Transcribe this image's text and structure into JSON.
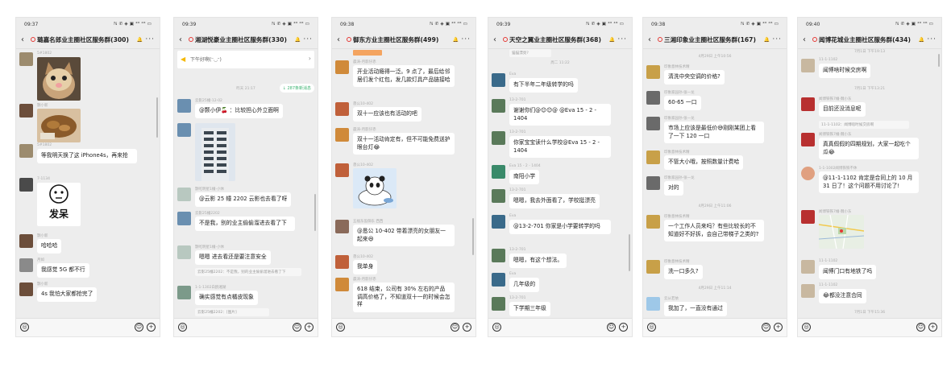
{
  "phones": [
    {
      "time": "09:37",
      "indicators": "ℕ ✆ ◈ ▣ ⁴ᴳ ⁴ᴳ ▭",
      "title": "璐嘉名郎业主圈社区服务群(300)",
      "items": [
        {
          "kind": "img",
          "name": "5#1802",
          "avatar": "#9c8b6e",
          "img": "cat"
        },
        {
          "kind": "img",
          "name": "颢小新",
          "avatar": "#6c4e3b",
          "img": "food"
        },
        {
          "kind": "text",
          "name": "5#1802",
          "avatar": "#9c8b6e",
          "text": "等我明天换了这 iPhone4s，再来抢"
        },
        {
          "kind": "img",
          "name": "7-1134",
          "avatar": "#4a4a4a",
          "img": "sticker",
          "sticker_text": "发呆"
        },
        {
          "kind": "text",
          "name": "颢小新",
          "avatar": "#6c4e3b",
          "text": "哈哈哈"
        },
        {
          "kind": "text",
          "name": "月如",
          "avatar": "#8a8a8a",
          "text": "我感觉 5G 都不行"
        },
        {
          "kind": "text",
          "name": "颢小新",
          "avatar": "#6c4e3b",
          "text": "4s 我怕大家都抢完了"
        }
      ]
    },
    {
      "time": "09:39",
      "indicators": "ℕ ✆ ◈ ▣ ⁴ᴳ ⁴ᴳ ▭",
      "title": "湘湖悦豪业主圈社区服务群(330)",
      "notice": "下午好啊(ᵔ◡ᵔ)",
      "time_label": "昨天 21:17",
      "new_msg": "↓ 287条新消息",
      "items": [
        {
          "kind": "text",
          "name": "云影25幢-12-02",
          "avatar": "#6a8fb0",
          "text": "@颢小伊🍒 ：比较担心外立面啊"
        },
        {
          "kind": "img",
          "name": "",
          "avatar": "#6a8fb0",
          "img": "building"
        },
        {
          "kind": "text",
          "name": "颢屹明星1幢-小休",
          "avatar": "#b8c8c0",
          "text": "@云影 25 幢 2202 云影也去看了呀"
        },
        {
          "kind": "text",
          "name": "云影25幢2202",
          "avatar": "#6a8fb0",
          "text": "不是我，别的业主偷偷溜进去看了下"
        },
        {
          "kind": "text",
          "name": "颢屹明星1幢-小休",
          "avatar": "#b8c8c0",
          "text": "嗯嗯 进去看还是要注意安全"
        },
        {
          "kind": "sys",
          "text": "云影25幢2202：不是我，别的业主偷偷溜进去看了下"
        },
        {
          "kind": "text",
          "name": "1-1-1302白鸥湘湖",
          "avatar": "#7c9a8a",
          "text": "确实感觉有点橘皮现象"
        },
        {
          "kind": "sys",
          "text": "云影25幢2202：[图片]"
        }
      ]
    },
    {
      "time": "09:38",
      "indicators": "ℕ ✆ ◈ ▣ ⁴ᴳ ⁴ᴳ ▭",
      "title": "御东方业主圈社区服务群(499)",
      "items": [
        {
          "kind": "text",
          "name": "晨涛-月影仔赤",
          "avatar": "#d08a3a",
          "text": "开业活动瘾得一泛。9 点了，最后给邻居们发个红包，发几款灯具产品链接哈"
        },
        {
          "kind": "text",
          "name": "恳公10-402",
          "avatar": "#c0603a",
          "text": "双十一应该也有活动的吧"
        },
        {
          "kind": "text",
          "name": "晨涛-月影仔赤",
          "avatar": "#d08a3a",
          "text": "双十一活动肯定有，但不可能免费送护眼台灯😂"
        },
        {
          "kind": "img",
          "name": "恳公10-402",
          "avatar": "#c0603a",
          "img": "panda"
        },
        {
          "kind": "text",
          "name": "五福东盈御东 西西",
          "avatar": "#8a6a5a",
          "text": "@恳公 10-402 带着漂亮的女朋友一起来😆"
        },
        {
          "kind": "text",
          "name": "恳公10-402",
          "avatar": "#c0603a",
          "text": "我单身"
        },
        {
          "kind": "text",
          "name": "晨涛-月影仔赤",
          "avatar": "#d08a3a",
          "text": "618 结束，公司有 30% 左右的产品调高价格了，不知道双十一的时候会怎样"
        }
      ]
    },
    {
      "time": "09:39",
      "indicators": "ℕ ✆ ◈ ▣ ⁴ᴳ ⁴ᴳ ▭",
      "title": "天空之翼业主圈社区服务群(368)",
      "top_text": "猫猫漂亮?",
      "time_label": "周二 11:22",
      "items": [
        {
          "kind": "text",
          "name": "Eva",
          "avatar": "#3a6a8a",
          "text": "有下半年二年级转学的吗"
        },
        {
          "kind": "text",
          "name": "13-2-701",
          "avatar": "#5a7a5a",
          "text": "谢谢你们@😊😊@ @Eva 15 - 2 - 1404"
        },
        {
          "kind": "text",
          "name": "13-2-701",
          "avatar": "#5a7a5a",
          "text": "你家宝宝读什么学校@Eva 15 - 2 - 1404"
        },
        {
          "kind": "text",
          "name": "Eva 15 - 2 - 1404",
          "avatar": "#3a8a6a",
          "text": "南阳小学"
        },
        {
          "kind": "text",
          "name": "13-2-701",
          "avatar": "#5a7a5a",
          "text": "嗯嗯，我去外面看了，学校挺漂亮"
        },
        {
          "kind": "text",
          "name": "Eva",
          "avatar": "#3a6a8a",
          "text": "@13-2-701 你家是小学要转学的吗"
        },
        {
          "kind": "text",
          "name": "13-2-701",
          "avatar": "#5a7a5a",
          "text": "嗯嗯，有这个想法。"
        },
        {
          "kind": "text",
          "name": "Eva",
          "avatar": "#3a6a8a",
          "text": "几年级的"
        },
        {
          "kind": "text",
          "name": "13-2-701",
          "avatar": "#5a7a5a",
          "text": "下学期三年级"
        }
      ]
    },
    {
      "time": "09:38",
      "indicators": "ℕ ✆ ◈ ▣ ⁴ᴳ ⁴ᴳ ▭",
      "title": "三湘印象业主圈社区服务群(167)",
      "items": [
        {
          "kind": "time",
          "text": "4月29日 上午10:56"
        },
        {
          "kind": "text",
          "name": "印象意林技术精",
          "avatar": "#c8a048",
          "text": "清洗中央空调的价格?"
        },
        {
          "kind": "text",
          "name": "印象家园孙-张一龙",
          "avatar": "#6a6a6a",
          "text": "60-65 一口"
        },
        {
          "kind": "text",
          "name": "印象家园孙-张一龙",
          "avatar": "#6a6a6a",
          "text": "市场上应该是最低价😅刚刚某团上看了一下 120 一口"
        },
        {
          "kind": "text",
          "name": "印象意林技术精",
          "avatar": "#c8a048",
          "text": "不管大小哦，按照数量计费哈"
        },
        {
          "kind": "text",
          "name": "印象家园孙-张一龙",
          "avatar": "#6a6a6a",
          "text": "对的"
        },
        {
          "kind": "time",
          "text": "4月29日 上午11:06"
        },
        {
          "kind": "text",
          "name": "印象意林技术精",
          "avatar": "#c8a048",
          "text": "一个工作人员来吗？有些比较长的不知道好不好拆，会自己带梯子之类的?"
        },
        {
          "kind": "text",
          "name": "印象意林技术精",
          "avatar": "#c8a048",
          "text": "洗一口多久?"
        },
        {
          "kind": "time",
          "text": "4月29日 上午11:14"
        },
        {
          "kind": "text",
          "name": "云从若依",
          "avatar": "#9ec8e8",
          "text": "我加了，一直没有通过"
        }
      ]
    },
    {
      "time": "09:40",
      "indicators": "ℕ ✆ ◈ ▣ ⁴ᴳ ⁴ᴳ ▭",
      "title": "闻博花城业主圈社区服务群(434)",
      "items": [
        {
          "kind": "time",
          "text": "7月1日 下午19:13"
        },
        {
          "kind": "text",
          "name": "11-1-1102",
          "avatar": "#c8b8a0",
          "text": "闻博啥时候交房啊"
        },
        {
          "kind": "time",
          "text": "7月1日 下午13:21"
        },
        {
          "kind": "text",
          "name": "闻博铁铁7幢-魏小东",
          "avatar": "#b83030",
          "text": "目前还没消息呢"
        },
        {
          "kind": "sys",
          "text": "11-1-1102：闻博啥时候交房啊"
        },
        {
          "kind": "text",
          "name": "闻博铁铁7幢-魏小东",
          "avatar": "#b83030",
          "text": "真真假假的四期规划，大家一起吃个瓜😂"
        },
        {
          "kind": "text",
          "name": "1-1-1002闻博铁铁不休",
          "avatar": "#e0a080",
          "text": "@11-1-1102 肯定是合同上的 10 月 31 日了！这个问题不用讨论了!"
        },
        {
          "kind": "img",
          "name": "闻博铁铁7幢-魏小东",
          "avatar": "#b83030",
          "img": "map"
        },
        {
          "kind": "text",
          "name": "11-1-1102",
          "avatar": "#c8b8a0",
          "text": "闻博门口有地铁了吗"
        },
        {
          "kind": "text",
          "name": "11-1-1102",
          "avatar": "#c8b8a0",
          "text": "😂都没注意合同"
        },
        {
          "kind": "time",
          "text": "7月1日 下午15:36"
        }
      ]
    }
  ]
}
